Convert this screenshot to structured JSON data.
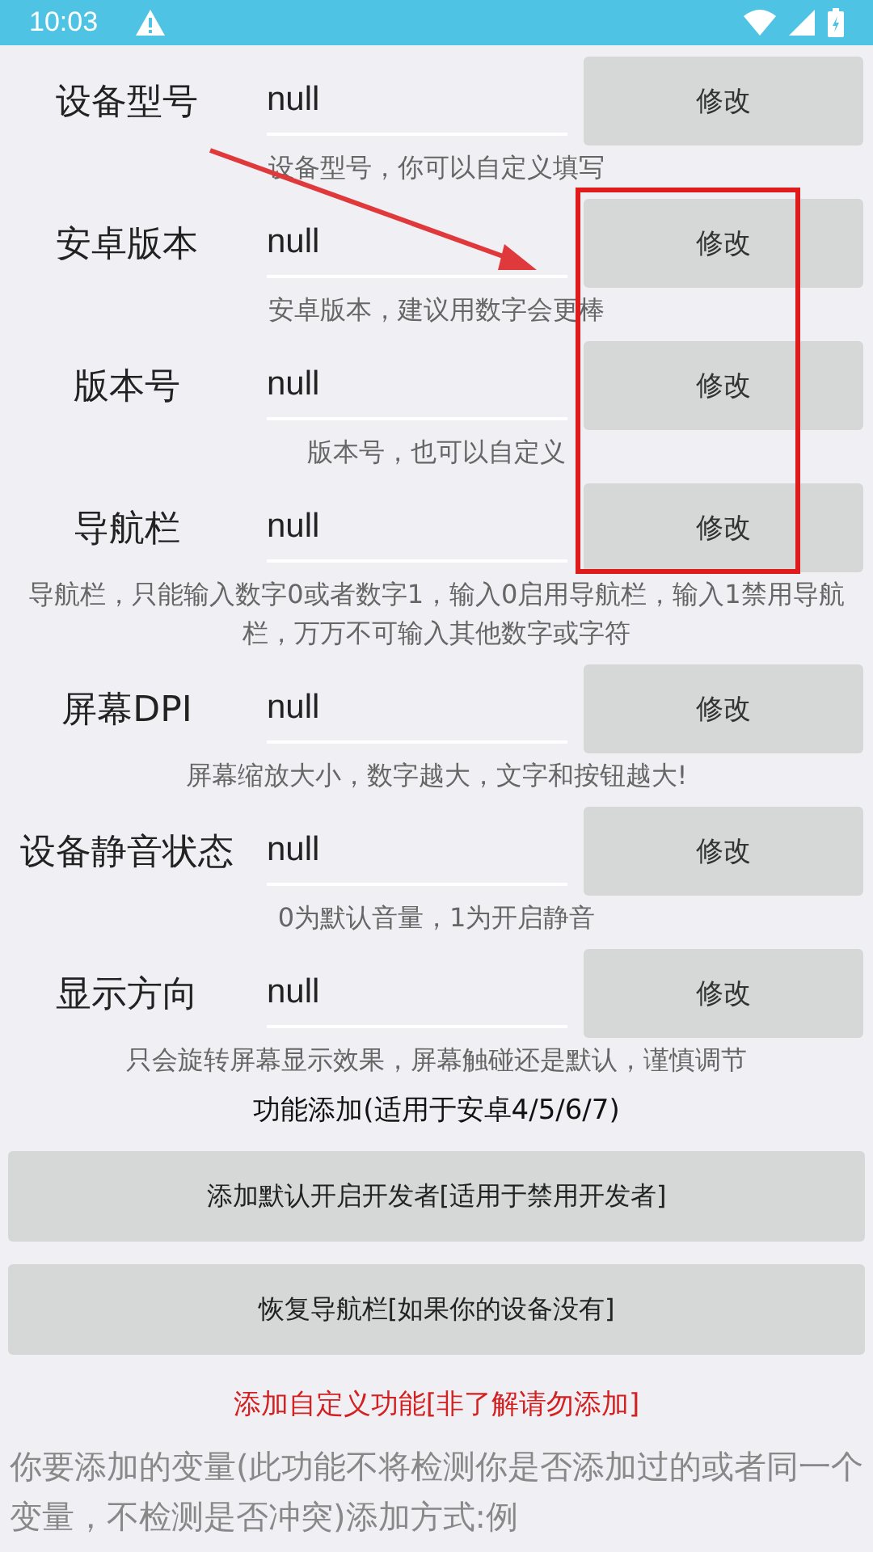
{
  "status_bar": {
    "time": "10:03"
  },
  "settings": [
    {
      "label": "设备型号",
      "value": "null",
      "button": "修改",
      "hint": "设备型号，你可以自定义填写"
    },
    {
      "label": "安卓版本",
      "value": "null",
      "button": "修改",
      "hint": "安卓版本，建议用数字会更棒"
    },
    {
      "label": "版本号",
      "value": "null",
      "button": "修改",
      "hint": "版本号，也可以自定义"
    },
    {
      "label": "导航栏",
      "value": "null",
      "button": "修改",
      "hint": "导航栏，只能输入数字0或者数字1，输入0启用导航栏，输入1禁用导航栏，万万不可输入其他数字或字符"
    },
    {
      "label": "屏幕DPI",
      "value": "null",
      "button": "修改",
      "hint": "屏幕缩放大小，数字越大，文字和按钮越大!"
    },
    {
      "label": "设备静音状态",
      "value": "null",
      "button": "修改",
      "hint": "0为默认音量，1为开启静音"
    },
    {
      "label": "显示方向",
      "value": "null",
      "button": "修改",
      "hint": "只会旋转屏幕显示效果，屏幕触碰还是默认，谨慎调节"
    }
  ],
  "features": {
    "title": "功能添加(适用于安卓4/5/6/7)",
    "buttons": [
      "添加默认开启开发者[适用于禁用开发者]",
      "恢复导航栏[如果你的设备没有]"
    ]
  },
  "custom": {
    "title": "添加自定义功能[非了解请勿添加]",
    "description": "你要添加的变量(此功能不将检测你是否添加过的或者同一个变量，不检测是否冲突)添加方式:例"
  }
}
